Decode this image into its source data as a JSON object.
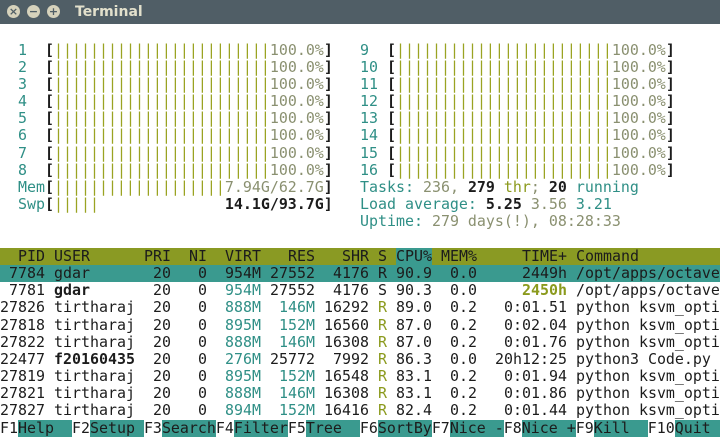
{
  "window": {
    "title": "Terminal",
    "close_icon": "close-icon",
    "minimize_icon": "minimize-icon",
    "maximize_icon": "maximize-icon"
  },
  "colors": {
    "teal": "#3a9a8f",
    "olive": "#8a9a23",
    "titlebar": "#505e66"
  },
  "cpus": [
    {
      "id": "1",
      "value": "100.0%"
    },
    {
      "id": "2",
      "value": "100.0%"
    },
    {
      "id": "3",
      "value": "100.0%"
    },
    {
      "id": "4",
      "value": "100.0%"
    },
    {
      "id": "5",
      "value": "100.0%"
    },
    {
      "id": "6",
      "value": "100.0%"
    },
    {
      "id": "7",
      "value": "100.0%"
    },
    {
      "id": "8",
      "value": "100.0%"
    },
    {
      "id": "9",
      "value": "100.0%"
    },
    {
      "id": "10",
      "value": "100.0%"
    },
    {
      "id": "11",
      "value": "100.0%"
    },
    {
      "id": "12",
      "value": "100.0%"
    },
    {
      "id": "13",
      "value": "100.0%"
    },
    {
      "id": "14",
      "value": "100.0%"
    },
    {
      "id": "15",
      "value": "100.0%"
    },
    {
      "id": "16",
      "value": "100.0%"
    }
  ],
  "cpu_fill": 1.0,
  "mem": {
    "label": "Mem",
    "value": "7.94G/62.7G",
    "fill": 1.0
  },
  "swp": {
    "label": "Swp",
    "value": "14.1G/93.7G",
    "fill": 0.15
  },
  "tasks": {
    "label": "Tasks: ",
    "count": "236",
    "sep": ", ",
    "threads": "279",
    "thr_label": " thr",
    "semi": "; ",
    "running": "20",
    "running_label": " running"
  },
  "load": {
    "label": "Load average: ",
    "one": "5.25",
    "five": "3.56",
    "fifteen": "3.21"
  },
  "uptime": {
    "label": "Uptime: ",
    "value": "279 days(!), 08:28:33"
  },
  "columns": [
    "PID",
    "USER",
    "PRI",
    "NI",
    "VIRT",
    "RES",
    "SHR",
    "S",
    "CPU%",
    "MEM%",
    "TIME+",
    "Command"
  ],
  "sort_column": "CPU%",
  "processes": [
    {
      "pid": "7784",
      "user": "gdar",
      "pri": "20",
      "ni": "0",
      "virt": "954M",
      "res": "27552",
      "shr": "4176",
      "s": "R",
      "cpu": "90.9",
      "mem": "0.0",
      "time": "2449h",
      "command": "/opt/apps/octave-",
      "selected": true,
      "user_bold": false
    },
    {
      "pid": "7781",
      "user": "gdar",
      "pri": "20",
      "ni": "0",
      "virt": "954M",
      "res": "27552",
      "shr": "4176",
      "s": "S",
      "cpu": "90.3",
      "mem": "0.0",
      "time": "2450h",
      "command": "/opt/apps/octave-",
      "selected": false,
      "user_bold": true
    },
    {
      "pid": "27826",
      "user": "tirtharaj",
      "pri": "20",
      "ni": "0",
      "virt": "888M",
      "res": "146M",
      "shr": "16292",
      "s": "R",
      "cpu": "89.0",
      "mem": "0.2",
      "time": "0:01.51",
      "command": "python ksvm_optim",
      "selected": false,
      "user_bold": false
    },
    {
      "pid": "27818",
      "user": "tirtharaj",
      "pri": "20",
      "ni": "0",
      "virt": "895M",
      "res": "152M",
      "shr": "16560",
      "s": "R",
      "cpu": "87.0",
      "mem": "0.2",
      "time": "0:02.04",
      "command": "python ksvm_optim",
      "selected": false,
      "user_bold": false
    },
    {
      "pid": "27822",
      "user": "tirtharaj",
      "pri": "20",
      "ni": "0",
      "virt": "888M",
      "res": "146M",
      "shr": "16308",
      "s": "R",
      "cpu": "87.0",
      "mem": "0.2",
      "time": "0:01.76",
      "command": "python ksvm_optim",
      "selected": false,
      "user_bold": false
    },
    {
      "pid": "22477",
      "user": "f20160435",
      "pri": "20",
      "ni": "0",
      "virt": "276M",
      "res": "25772",
      "shr": "7992",
      "s": "R",
      "cpu": "86.3",
      "mem": "0.0",
      "time": "20h12:25",
      "command": "python3 Code.py",
      "selected": false,
      "user_bold": true
    },
    {
      "pid": "27819",
      "user": "tirtharaj",
      "pri": "20",
      "ni": "0",
      "virt": "895M",
      "res": "152M",
      "shr": "16548",
      "s": "R",
      "cpu": "83.1",
      "mem": "0.2",
      "time": "0:01.94",
      "command": "python ksvm_optim",
      "selected": false,
      "user_bold": false
    },
    {
      "pid": "27821",
      "user": "tirtharaj",
      "pri": "20",
      "ni": "0",
      "virt": "888M",
      "res": "146M",
      "shr": "16308",
      "s": "R",
      "cpu": "83.1",
      "mem": "0.2",
      "time": "0:01.86",
      "command": "python ksvm_optim",
      "selected": false,
      "user_bold": false
    },
    {
      "pid": "27827",
      "user": "tirtharaj",
      "pri": "20",
      "ni": "0",
      "virt": "894M",
      "res": "152M",
      "shr": "16416",
      "s": "R",
      "cpu": "82.4",
      "mem": "0.2",
      "time": "0:01.44",
      "command": "python ksvm_optim",
      "selected": false,
      "user_bold": false
    }
  ],
  "function_keys": [
    {
      "key": "F1",
      "label": "Help  "
    },
    {
      "key": "F2",
      "label": "Setup "
    },
    {
      "key": "F3",
      "label": "Search"
    },
    {
      "key": "F4",
      "label": "Filter"
    },
    {
      "key": "F5",
      "label": "Tree  "
    },
    {
      "key": "F6",
      "label": "SortBy"
    },
    {
      "key": "F7",
      "label": "Nice -"
    },
    {
      "key": "F8",
      "label": "Nice +"
    },
    {
      "key": "F9",
      "label": "Kill  "
    },
    {
      "key": "F10",
      "label": "Quit  "
    }
  ]
}
